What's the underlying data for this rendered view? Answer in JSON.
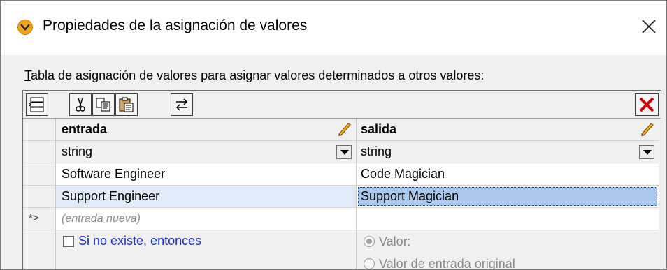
{
  "window": {
    "title": "Propiedades de la asignación de valores",
    "icon": "altova-mapforce-icon",
    "close_icon": "close-icon"
  },
  "description": "Tabla de asignación de valores para asignar valores determinados a otros valores:",
  "description_accelerator": "T",
  "toolbar": {
    "buttons": [
      "insert-row-icon",
      "cut-icon",
      "copy-icon",
      "paste-icon",
      "swap-columns-icon",
      "delete-row-icon"
    ]
  },
  "table": {
    "columns": [
      {
        "header": "entrada",
        "type": "string"
      },
      {
        "header": "salida",
        "type": "string"
      }
    ],
    "rows": [
      {
        "input": "Software Engineer",
        "output": "Code Magician"
      },
      {
        "input": "Support Engineer",
        "output": "Support Magician"
      }
    ],
    "new_row_marker": "*>",
    "new_row_placeholder": "(entrada nueva)"
  },
  "otherwise": {
    "checkbox_label": "Si no existe, entonces",
    "checked": false,
    "options": [
      {
        "label": "Valor:",
        "selected": true
      },
      {
        "label": "Valor de entrada original",
        "selected": false
      }
    ]
  },
  "colors": {
    "selection": "#a9c8ec",
    "row_highlight": "#e1ebf7",
    "link_blue": "#1a2fd0",
    "delete_red": "#d40000"
  }
}
